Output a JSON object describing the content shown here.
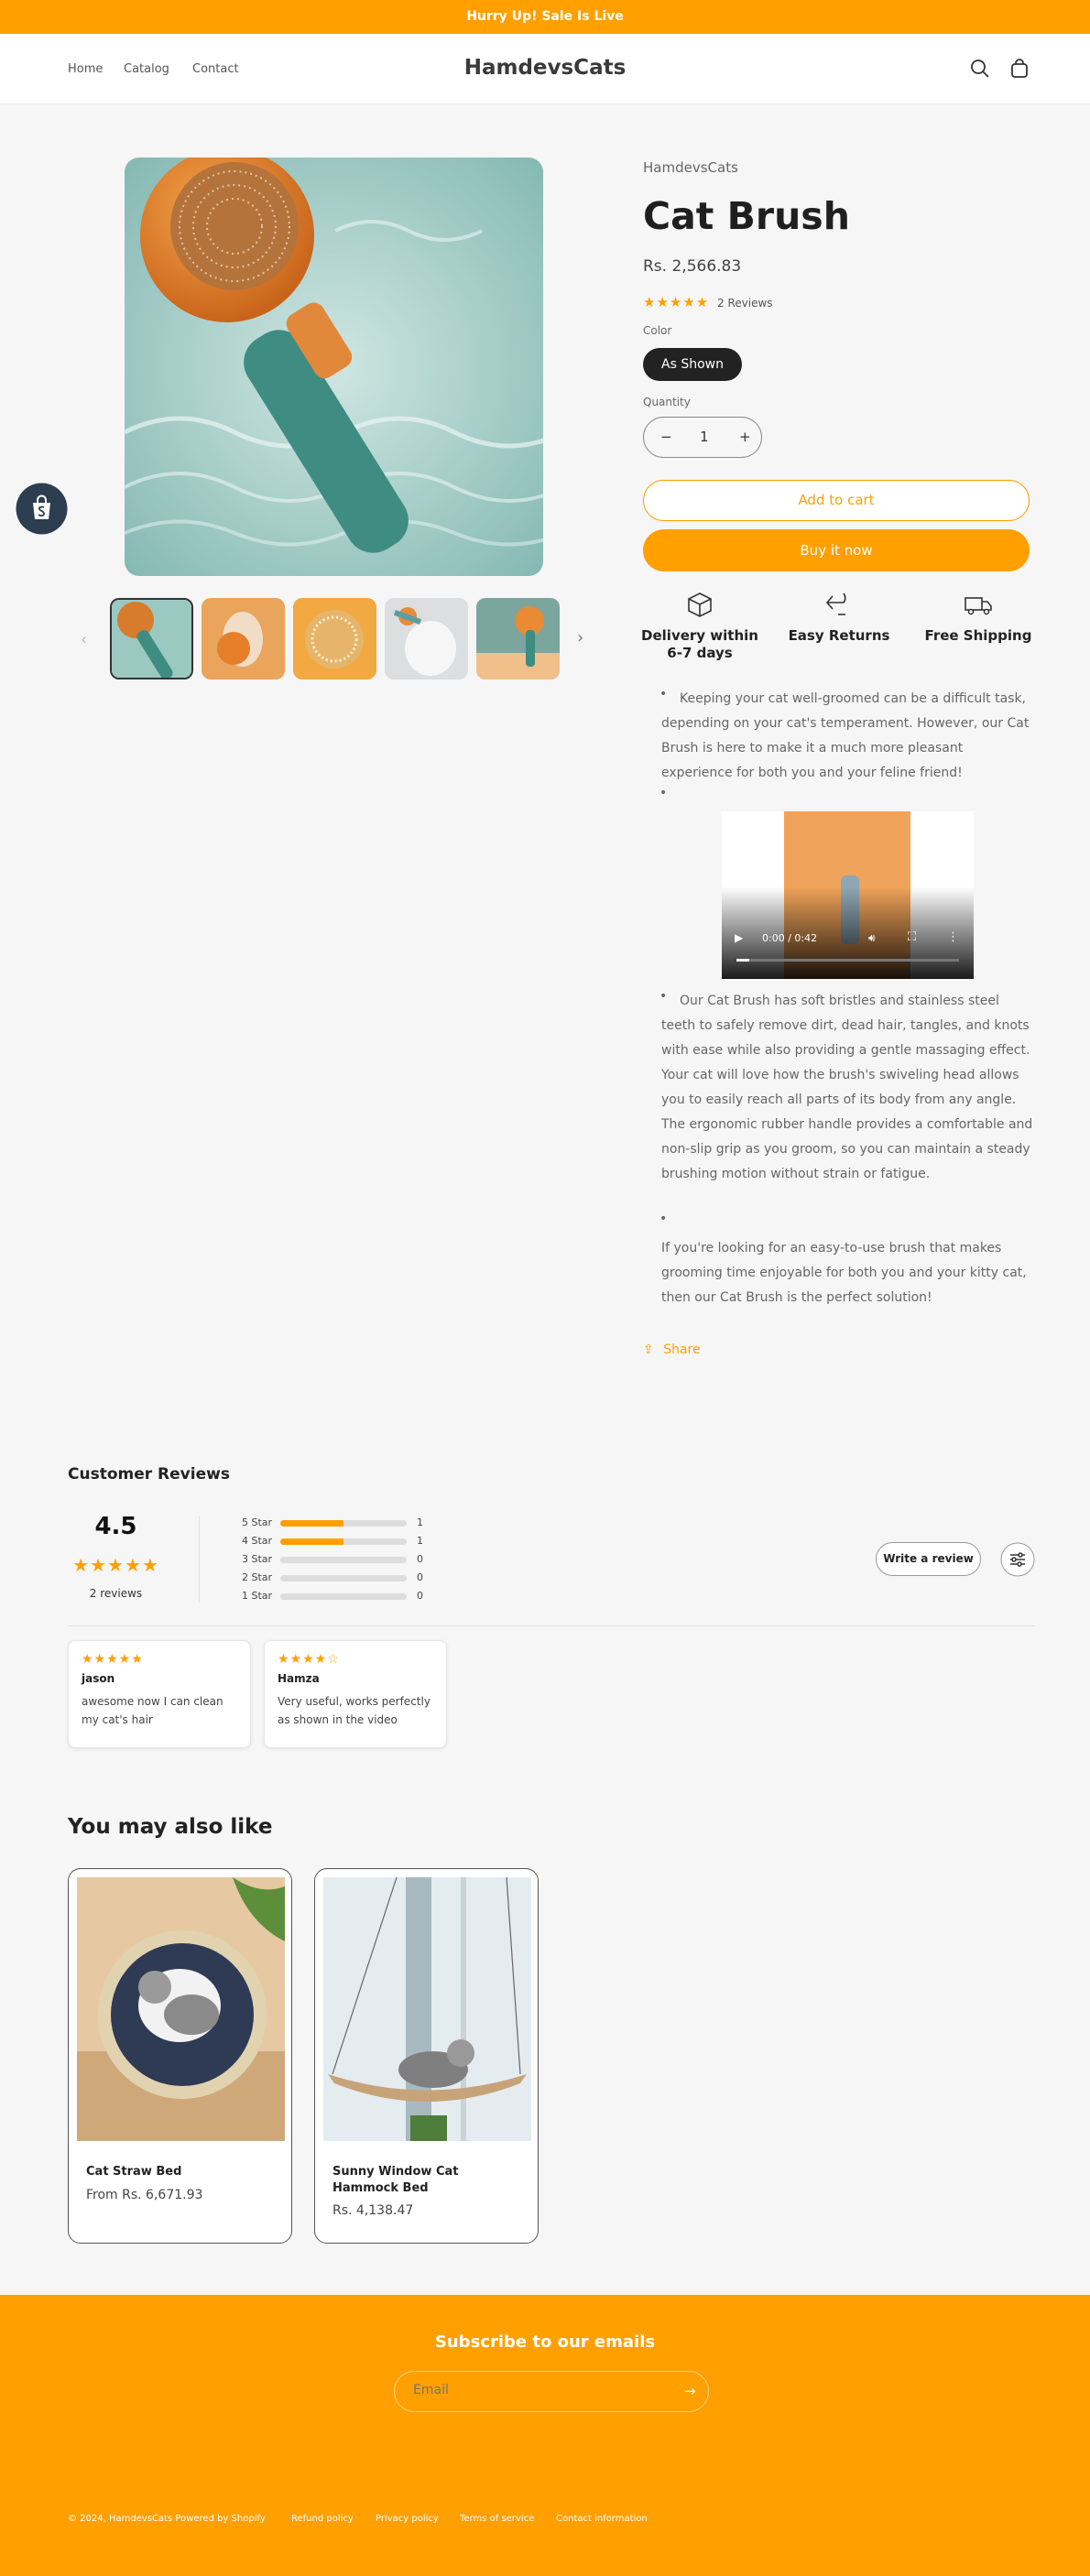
{
  "announcement": "Hurry Up! Sale Is Live",
  "header": {
    "nav": [
      "Home",
      "Catalog",
      "Contact"
    ],
    "store_name": "HamdevsCats",
    "search_icon": "search-icon",
    "cart_icon": "cart-icon"
  },
  "product": {
    "vendor": "HamdevsCats",
    "title": "Cat Brush",
    "price": "Rs. 2,566.83",
    "rating_stars": "★★★★★",
    "reviews_label": "2 Reviews",
    "color_label": "Color",
    "color_value": "As Shown",
    "quantity_label": "Quantity",
    "quantity_value": "1",
    "minus": "−",
    "plus": "+",
    "add_to_cart": "Add to cart",
    "buy_now": "Buy it now",
    "features": [
      {
        "icon": "box-icon",
        "title": "Delivery within 6-7 days"
      },
      {
        "icon": "return-arrow-icon",
        "title": "Easy Returns"
      },
      {
        "icon": "truck-icon",
        "title": "Free Shipping"
      }
    ],
    "desc_1": "Keeping your cat well-groomed can be a difficult task, depending on your cat's temperament. However, our Cat Brush is here to make it a much more pleasant experience for both you and your feline friend!",
    "video_time": "0:00 / 0:42",
    "desc_2": "Our Cat Brush has soft bristles and stainless steel teeth to safely remove dirt, dead hair, tangles, and knots with ease while also providing a gentle massaging effect. Your cat will love how the brush's swiveling head allows you to easily reach all parts of its body from any angle.  The ergonomic rubber handle provides a comfortable and non-slip grip as you groom, so you can maintain a steady brushing motion without strain or fatigue.",
    "desc_3": "If you're looking for an easy-to-use brush that makes grooming time enjoyable for both you and your kitty cat, then our Cat Brush is the perfect solution!",
    "share": "Share"
  },
  "reviews": {
    "title": "Customer Reviews",
    "average": "4.5",
    "stars": "★★★★★",
    "count_label": "2 reviews",
    "bars": [
      {
        "label": "5 Star",
        "count": "1",
        "fraction": 0.5
      },
      {
        "label": "4 Star",
        "count": "1",
        "fraction": 0.5
      },
      {
        "label": "3 Star",
        "count": "0",
        "fraction": 0
      },
      {
        "label": "2 Star",
        "count": "0",
        "fraction": 0
      },
      {
        "label": "1 Star",
        "count": "0",
        "fraction": 0
      }
    ],
    "write_review": "Write a review",
    "filter_icon": "sliders-icon",
    "items": [
      {
        "stars": "★★★★★",
        "name": "jason",
        "text": "awesome now I can clean my cat's hair"
      },
      {
        "stars": "★★★★☆",
        "name": "Hamza",
        "text": "Very useful, works perfectly as shown in the video"
      }
    ]
  },
  "related": {
    "title": "You may also like",
    "products": [
      {
        "name": "Cat Straw Bed",
        "price": "From Rs. 6,671.93"
      },
      {
        "name": "Sunny Window Cat Hammock Bed",
        "price": "Rs. 4,138.47"
      }
    ]
  },
  "footer": {
    "subscribe_title": "Subscribe to our emails",
    "email_placeholder": "Email",
    "copyright": "© 2024, HamdevsCats Powered by Shopify",
    "links": [
      "Refund policy",
      "Privacy policy",
      "Terms of service",
      "Contact information"
    ]
  },
  "colors": {
    "accent": "#ff9f00",
    "dark": "#222222"
  }
}
